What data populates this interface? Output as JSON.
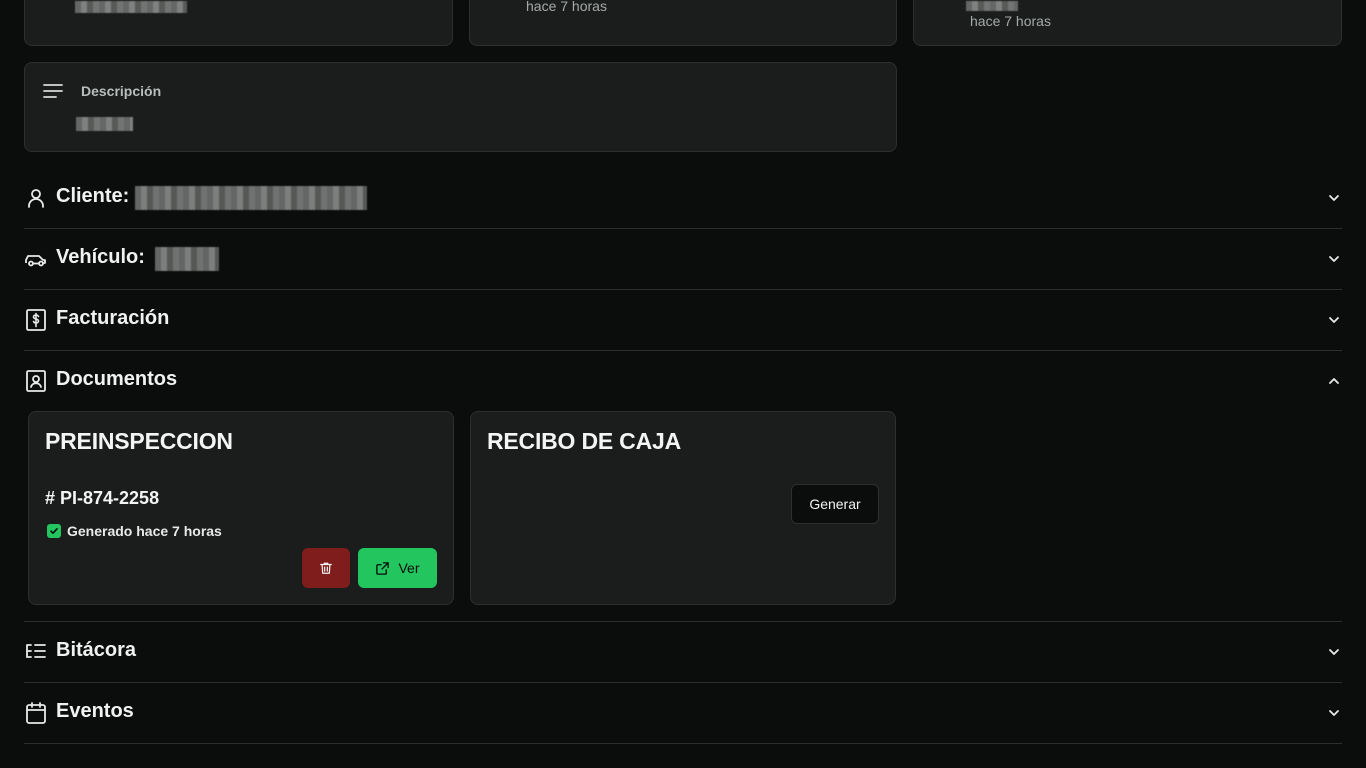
{
  "top_cards": [
    {
      "time": "hace 7 horas"
    },
    {
      "time": "hace 7 horas"
    }
  ],
  "description": {
    "label": "Descripción"
  },
  "sections": {
    "cliente": {
      "label": "Cliente:"
    },
    "vehiculo": {
      "label": "Vehículo:"
    },
    "facturacion": {
      "label": "Facturación"
    },
    "documentos": {
      "label": "Documentos"
    },
    "bitacora": {
      "label": "Bitácora"
    },
    "eventos": {
      "label": "Eventos"
    }
  },
  "documents": {
    "preinspeccion": {
      "title": "PREINSPECCION",
      "number": "# PI-874-2258",
      "status": "Generado hace 7 horas",
      "view_label": "Ver"
    },
    "recibo": {
      "title": "RECIBO DE CAJA",
      "generate_label": "Generar"
    }
  },
  "icons": {
    "description": "lines-icon",
    "cliente": "user-icon",
    "vehiculo": "car-icon",
    "facturacion": "receipt-icon",
    "documentos": "contact-book-icon",
    "bitacora": "list-tree-icon",
    "eventos": "calendar-icon"
  },
  "colors": {
    "background": "#0b0c0c",
    "card": "#1a1d1c",
    "border": "#2b302e",
    "success": "#22c55e",
    "danger": "#7f1d1d"
  }
}
